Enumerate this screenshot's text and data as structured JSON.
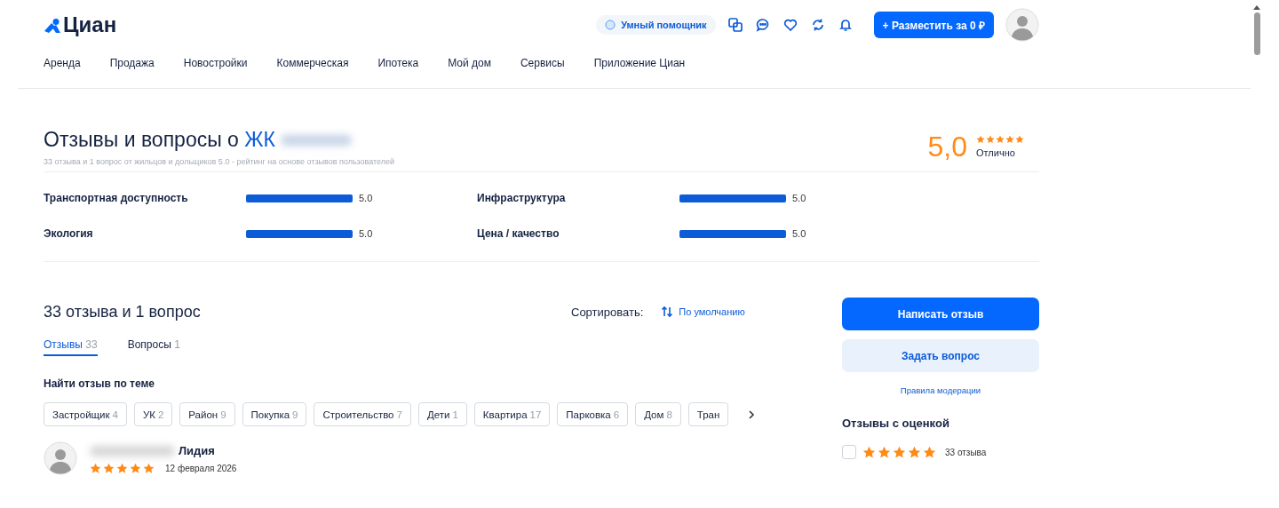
{
  "header": {
    "logo": "Циан",
    "assistant": "Умный помощник",
    "post_button": "+ Разместить за 0 ₽"
  },
  "nav": [
    "Аренда",
    "Продажа",
    "Новостройки",
    "Коммерческая",
    "Ипотека",
    "Мой дом",
    "Сервисы",
    "Приложение Циан"
  ],
  "summary": {
    "title": "Отзывы и вопросы о ",
    "title_link": "ЖК",
    "subtitle": "33 отзыва и 1 вопрос от жильцов и дольщиков 5.0 - рейтинг на основе отзывов пользователей",
    "score": "5,0",
    "stars": 5,
    "verdict": "Отлично"
  },
  "criteria": [
    {
      "label": "Транспортная доступность",
      "level": 1,
      "reading": "5.0"
    },
    {
      "label": "Инфраструктура",
      "level": 1,
      "reading": "5.0"
    },
    {
      "label": "Экология",
      "level": 1,
      "reading": "5.0"
    },
    {
      "label": "Цена / качество",
      "level": 1,
      "reading": "5.0"
    }
  ],
  "reviews": {
    "heading": "33 отзыва и 1 вопрос",
    "sort_label": "Сортировать:",
    "sort_value": "По умолчанию",
    "tabs": [
      {
        "label": "Отзывы",
        "count": "33",
        "selected": true
      },
      {
        "label": "Вопросы",
        "count": "1",
        "selected": false
      }
    ],
    "topic_heading": "Найти отзыв по теме",
    "topics": [
      {
        "label": "Застройщик",
        "count": "4"
      },
      {
        "label": "УК",
        "count": "2"
      },
      {
        "label": "Район",
        "count": "9"
      },
      {
        "label": "Покупка",
        "count": "9"
      },
      {
        "label": "Строительство",
        "count": "7"
      },
      {
        "label": "Дети",
        "count": "1"
      },
      {
        "label": "Квартира",
        "count": "17"
      },
      {
        "label": "Парковка",
        "count": "6"
      },
      {
        "label": "Дом",
        "count": "8"
      },
      {
        "label": "Тран"
      }
    ],
    "items": [
      {
        "author": "Лидия",
        "stars": 5,
        "date": "12 февраля 2026"
      }
    ]
  },
  "sidebar": {
    "write_button": "Написать отзыв",
    "ask_button": "Задать вопрос",
    "rules_link": "Правила модерации",
    "filter_heading": "Отзывы с оценкой",
    "filters": [
      {
        "checked": false,
        "stars": 5,
        "count": "33 отзыва"
      }
    ]
  }
}
